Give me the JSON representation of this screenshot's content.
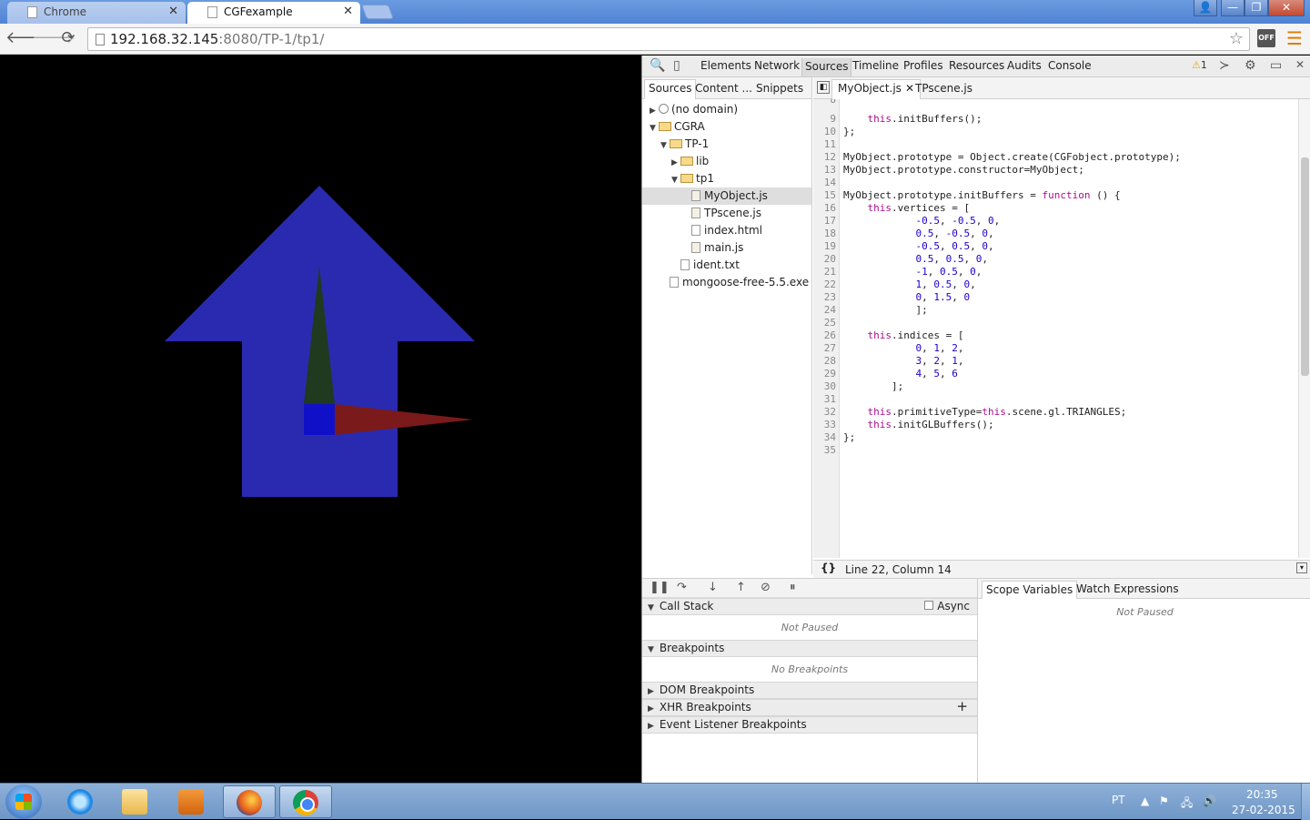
{
  "browser": {
    "tabs": [
      {
        "label": "Chrome"
      },
      {
        "label": "CGFexample"
      }
    ],
    "url_host": "192.168.32.145",
    "url_rest": ":8080/TP-1/tp1/",
    "ext_label": "OFF"
  },
  "viewport": {
    "colors": {
      "arrow": "#2a2ab0",
      "green_axis": "#1f3a1f",
      "red_axis": "#7a1a1a",
      "origin": "#1010c8"
    }
  },
  "devtools": {
    "tabs": [
      "Elements",
      "Network",
      "Sources",
      "Timeline",
      "Profiles",
      "Resources",
      "Audits",
      "Console"
    ],
    "active_tab": "Sources",
    "warning_count": "1",
    "navigator": {
      "tabs": [
        "Sources",
        "Content ...",
        "Snippets"
      ],
      "tree": [
        {
          "label": "(no domain)",
          "kind": "globe",
          "depth": 0,
          "toggle": "▶"
        },
        {
          "label": "CGRA",
          "kind": "folder",
          "depth": 0,
          "toggle": "▼"
        },
        {
          "label": "TP-1",
          "kind": "folder",
          "depth": 1,
          "toggle": "▼"
        },
        {
          "label": "lib",
          "kind": "folder",
          "depth": 2,
          "toggle": "▶"
        },
        {
          "label": "tp1",
          "kind": "folder",
          "depth": 2,
          "toggle": "▼"
        },
        {
          "label": "MyObject.js",
          "kind": "js",
          "depth": 3,
          "toggle": "",
          "selected": true
        },
        {
          "label": "TPscene.js",
          "kind": "js",
          "depth": 3,
          "toggle": ""
        },
        {
          "label": "index.html",
          "kind": "html",
          "depth": 3,
          "toggle": ""
        },
        {
          "label": "main.js",
          "kind": "js",
          "depth": 3,
          "toggle": ""
        },
        {
          "label": "ident.txt",
          "kind": "file",
          "depth": 2,
          "toggle": ""
        },
        {
          "label": "mongoose-free-5.5.exe",
          "kind": "file",
          "depth": 1,
          "toggle": ""
        }
      ]
    },
    "editor": {
      "tabs": [
        "MyObject.js",
        "TPscene.js"
      ],
      "lines": [
        {
          "n": "8",
          "code": ""
        },
        {
          "n": "9",
          "code": "    <kw>this</kw>.initBuffers();"
        },
        {
          "n": "10",
          "code": "};"
        },
        {
          "n": "11",
          "code": ""
        },
        {
          "n": "12",
          "code": "MyObject.prototype = Object.create(CGFobject.prototype);"
        },
        {
          "n": "13",
          "code": "MyObject.prototype.constructor=MyObject;"
        },
        {
          "n": "14",
          "code": ""
        },
        {
          "n": "15",
          "code": "MyObject.prototype.initBuffers = <kw>function</kw> () {"
        },
        {
          "n": "16",
          "code": "    <kw>this</kw>.vertices = ["
        },
        {
          "n": "17",
          "code": "            <num>-0.5</num>, <num>-0.5</num>, <num>0</num>,"
        },
        {
          "n": "18",
          "code": "            <num>0.5</num>, <num>-0.5</num>, <num>0</num>,"
        },
        {
          "n": "19",
          "code": "            <num>-0.5</num>, <num>0.5</num>, <num>0</num>,"
        },
        {
          "n": "20",
          "code": "            <num>0.5</num>, <num>0.5</num>, <num>0</num>,"
        },
        {
          "n": "21",
          "code": "            <num>-1</num>, <num>0.5</num>, <num>0</num>,"
        },
        {
          "n": "22",
          "code": "            <num>1</num>, <num>0.5</num>, <num>0</num>,"
        },
        {
          "n": "23",
          "code": "            <num>0</num>, <num>1.5</num>, <num>0</num>"
        },
        {
          "n": "24",
          "code": "            ];"
        },
        {
          "n": "25",
          "code": ""
        },
        {
          "n": "26",
          "code": "    <kw>this</kw>.indices = ["
        },
        {
          "n": "27",
          "code": "            <num>0</num>, <num>1</num>, <num>2</num>,"
        },
        {
          "n": "28",
          "code": "            <num>3</num>, <num>2</num>, <num>1</num>,"
        },
        {
          "n": "29",
          "code": "            <num>4</num>, <num>5</num>, <num>6</num>"
        },
        {
          "n": "30",
          "code": "        ];"
        },
        {
          "n": "31",
          "code": ""
        },
        {
          "n": "32",
          "code": "    <kw>this</kw>.primitiveType=<kw>this</kw>.scene.gl.TRIANGLES;"
        },
        {
          "n": "33",
          "code": "    <kw>this</kw>.initGLBuffers();"
        },
        {
          "n": "34",
          "code": "};"
        },
        {
          "n": "35",
          "code": ""
        }
      ],
      "cursor_position": "Line 22, Column 14",
      "pretty_print_label": "{}"
    },
    "debugger": {
      "call_stack_label": "Call Stack",
      "async_label": "Async",
      "call_stack_empty": "Not Paused",
      "breakpoints_label": "Breakpoints",
      "breakpoints_empty": "No Breakpoints",
      "dom_breakpoints_label": "DOM Breakpoints",
      "xhr_breakpoints_label": "XHR Breakpoints",
      "event_breakpoints_label": "Event Listener Breakpoints"
    },
    "scope": {
      "tabs": [
        "Scope Variables",
        "Watch Expressions"
      ],
      "empty": "Not Paused"
    }
  },
  "taskbar": {
    "language": "PT",
    "time": "20:35",
    "date": "27-02-2015"
  }
}
